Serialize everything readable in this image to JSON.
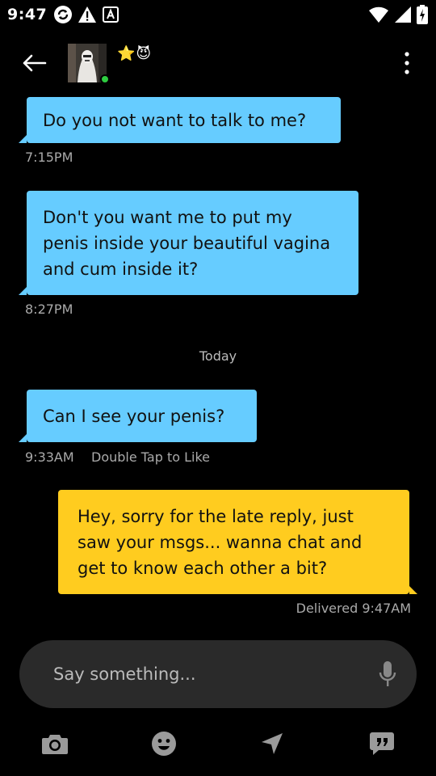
{
  "status_bar": {
    "time": "9:47",
    "left_icons": [
      "sync-icon",
      "warning-icon",
      "keyboard-a-icon"
    ],
    "right_icons": [
      "wifi-icon",
      "signal-icon",
      "battery-charging-icon"
    ]
  },
  "header": {
    "name_emojis": "⭐😈",
    "online": true,
    "online_color": "#2ecc40"
  },
  "messages": [
    {
      "direction": "incoming",
      "text": "Do you not want to talk to me?",
      "time": "7:15PM"
    },
    {
      "direction": "incoming",
      "lines": [
        "Don't you want me to put my",
        "penis inside your beautiful vagina",
        "and cum inside it?"
      ],
      "time": "8:27PM"
    },
    {
      "direction": "incoming",
      "text": "Can I see your penis?",
      "time": "9:33AM",
      "hint": "Double Tap to Like"
    },
    {
      "direction": "outgoing",
      "lines": [
        "Hey, sorry for the late reply, just",
        "saw your msgs... wanna chat and",
        "get to know each other a bit?"
      ],
      "status": "Delivered 9:47AM"
    }
  ],
  "day_separator": "Today",
  "composer": {
    "placeholder": "Say something..."
  },
  "toolbar": {
    "items": [
      "camera-icon",
      "emoji-icon",
      "location-icon",
      "quick-reply-icon"
    ]
  },
  "colors": {
    "incoming_bubble": "#66ccff",
    "outgoing_bubble": "#ffcc1f",
    "background": "#000000",
    "composer": "#2a2a2a"
  }
}
